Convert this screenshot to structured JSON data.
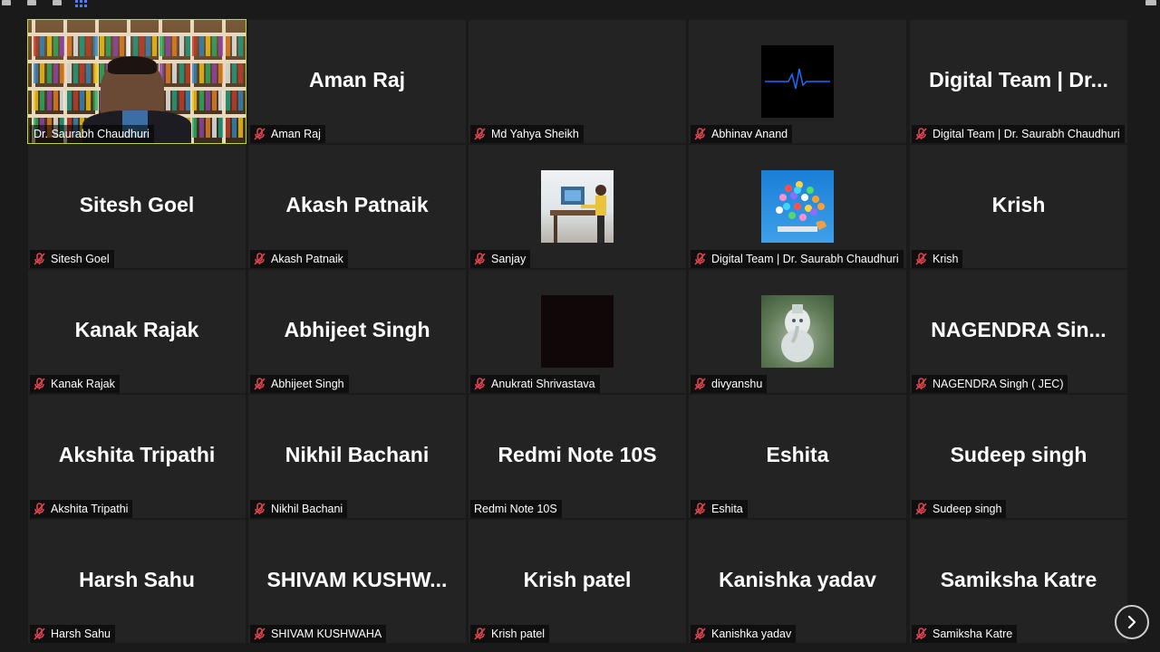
{
  "participants": [
    {
      "display": "",
      "label": "Dr. Saurabh Chaudhuri",
      "kind": "video",
      "muted": false
    },
    {
      "display": "Aman Raj",
      "label": "Aman Raj",
      "kind": "name",
      "muted": true
    },
    {
      "display": "",
      "label": "Md Yahya Sheikh",
      "kind": "blank",
      "muted": true
    },
    {
      "display": "",
      "label": "Abhinav Anand",
      "kind": "heartbeat",
      "muted": true
    },
    {
      "display": "Digital Team | Dr...",
      "label": "Digital Team | Dr. Saurabh Chaudhuri",
      "kind": "name",
      "muted": true
    },
    {
      "display": "Sitesh Goel",
      "label": "Sitesh Goel",
      "kind": "name",
      "muted": true
    },
    {
      "display": "Akash Patnaik",
      "label": "Akash Patnaik",
      "kind": "name",
      "muted": true
    },
    {
      "display": "",
      "label": "Sanjay",
      "kind": "desk",
      "muted": true
    },
    {
      "display": "",
      "label": "Digital Team | Dr. Saurabh Chaudhuri",
      "kind": "bubbles",
      "muted": true
    },
    {
      "display": "Krish",
      "label": "Krish",
      "kind": "name",
      "muted": true
    },
    {
      "display": "Kanak Rajak",
      "label": "Kanak Rajak",
      "kind": "name",
      "muted": true
    },
    {
      "display": "Abhijeet Singh",
      "label": "Abhijeet Singh",
      "kind": "name",
      "muted": true
    },
    {
      "display": "",
      "label": "Anukrati Shrivastava",
      "kind": "dark",
      "muted": true
    },
    {
      "display": "",
      "label": "divyanshu",
      "kind": "statue",
      "muted": true
    },
    {
      "display": "NAGENDRA  Sin...",
      "label": "NAGENDRA Singh ( JEC)",
      "kind": "name",
      "muted": true
    },
    {
      "display": "Akshita Tripathi",
      "label": "Akshita Tripathi",
      "kind": "name",
      "muted": true
    },
    {
      "display": "Nikhil Bachani",
      "label": "Nikhil Bachani",
      "kind": "name",
      "muted": true
    },
    {
      "display": "Redmi Note 10S",
      "label": "Redmi Note 10S",
      "kind": "name",
      "muted": false
    },
    {
      "display": "Eshita",
      "label": "Eshita",
      "kind": "name",
      "muted": true
    },
    {
      "display": "Sudeep singh",
      "label": "Sudeep singh",
      "kind": "name",
      "muted": true
    },
    {
      "display": "Harsh Sahu",
      "label": "Harsh Sahu",
      "kind": "name",
      "muted": true
    },
    {
      "display": "SHIVAM  KUSHW...",
      "label": "SHIVAM KUSHWAHA",
      "kind": "name",
      "muted": true
    },
    {
      "display": "Krish patel",
      "label": "Krish patel",
      "kind": "name",
      "muted": true
    },
    {
      "display": "Kanishka yadav",
      "label": "Kanishka yadav",
      "kind": "name",
      "muted": true
    },
    {
      "display": "Samiksha Katre",
      "label": "Samiksha Katre",
      "kind": "name",
      "muted": true
    }
  ],
  "icons": {
    "muted": "mic-muted-icon",
    "next": "chevron-right-icon",
    "grid": "gallery-view-icon"
  },
  "colors": {
    "active_speaker": "#b9d94a",
    "muted_icon": "#e0454f",
    "tile_bg": "#232323"
  }
}
